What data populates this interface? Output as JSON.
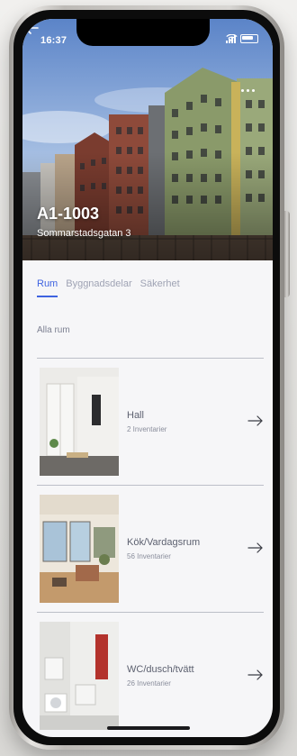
{
  "status_bar": {
    "time": "16:37"
  },
  "header": {
    "title": "A1-1003",
    "address": "Sommarstadsgatan 3"
  },
  "tabs": [
    {
      "label": "Rum",
      "active": true
    },
    {
      "label": "Byggnadsdelar",
      "active": false
    },
    {
      "label": "Säkerhet",
      "active": false
    }
  ],
  "section_label": "Alla rum",
  "rooms": [
    {
      "name": "Hall",
      "count": "2 Inventarier"
    },
    {
      "name": "Kök/Vardagsrum",
      "count": "56 Inventarier"
    },
    {
      "name": "WC/dusch/tvätt",
      "count": "26 Inventarier"
    }
  ],
  "colors": {
    "accent": "#3f63e0",
    "text_muted": "#9fa3b4",
    "divider": "#bcbfc8"
  },
  "icons": [
    "back-arrow-icon",
    "more-dots-icon",
    "signal-icon",
    "wifi-icon",
    "battery-icon",
    "arrow-right-icon"
  ]
}
